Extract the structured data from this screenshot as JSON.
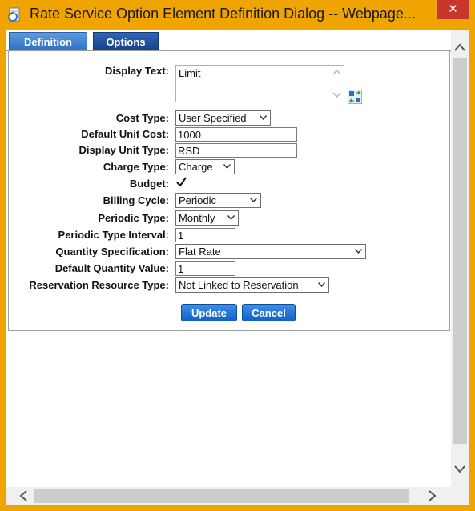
{
  "window": {
    "title": "Rate Service Option Element Definition Dialog -- Webpage...",
    "close_glyph": "✕"
  },
  "tabs": [
    {
      "label": "Definition",
      "active": true
    },
    {
      "label": "Options",
      "active": false
    }
  ],
  "form": {
    "display_text_label": "Display Text:",
    "display_text_value": "Limit",
    "cost_type_label": "Cost Type:",
    "cost_type_value": "User Specified",
    "default_unit_cost_label": "Default Unit Cost:",
    "default_unit_cost_value": "1000",
    "display_unit_type_label": "Display Unit Type:",
    "display_unit_type_value": "RSD",
    "charge_type_label": "Charge Type:",
    "charge_type_value": "Charge",
    "budget_label": "Budget:",
    "budget_checked": true,
    "billing_cycle_label": "Billing Cycle:",
    "billing_cycle_value": "Periodic",
    "periodic_type_label": "Periodic Type:",
    "periodic_type_value": "Monthly",
    "periodic_type_interval_label": "Periodic Type Interval:",
    "periodic_type_interval_value": "1",
    "quantity_specification_label": "Quantity Specification:",
    "quantity_specification_value": "Flat Rate",
    "default_quantity_value_label": "Default Quantity Value:",
    "default_quantity_value_value": "1",
    "reservation_resource_type_label": "Reservation Resource Type:",
    "reservation_resource_type_value": "Not Linked to Reservation"
  },
  "buttons": {
    "update_label": "Update",
    "cancel_label": "Cancel"
  },
  "icons": {
    "window_icon": "ie-page-icon",
    "swap": "translate-swap-icon",
    "dropdown": "chevron-down-icon"
  },
  "colors": {
    "title_bar": "#f0a400",
    "close_button": "#c7372b",
    "button_blue": "#1262c6",
    "tab_active": "#3d82d4",
    "tab_inactive": "#1f4d9c"
  }
}
